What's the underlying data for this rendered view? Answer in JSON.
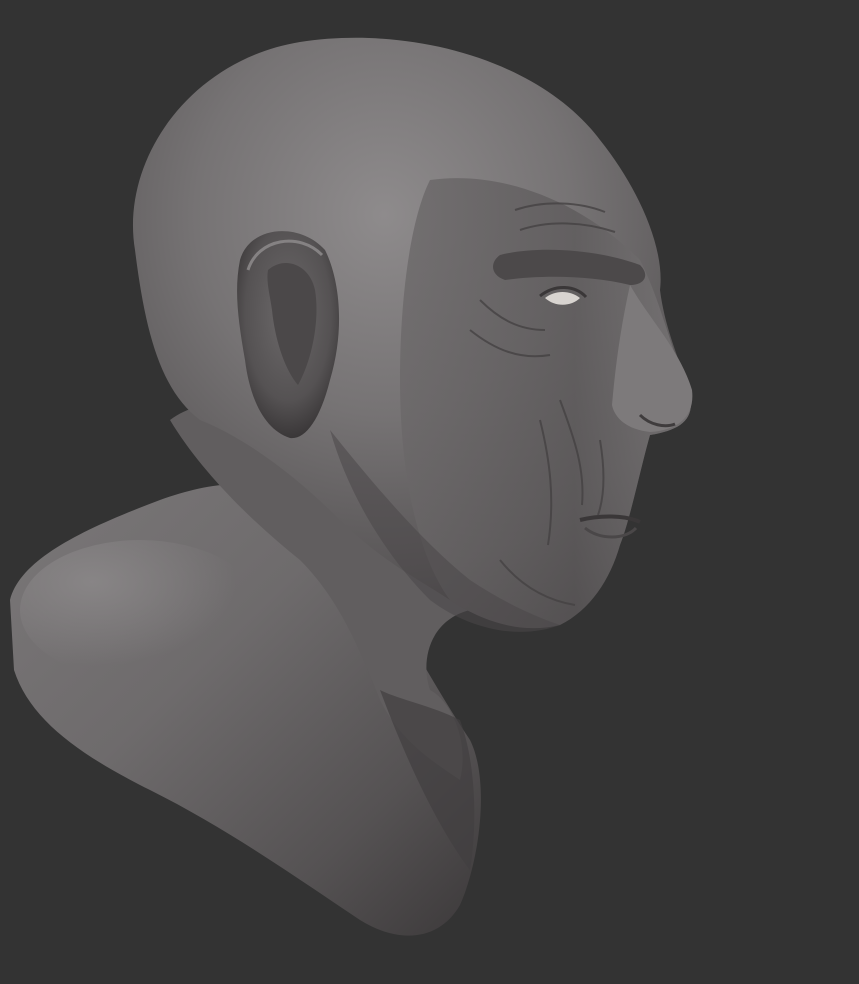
{
  "scene": {
    "subject": "sculpted-head-bust",
    "material": "clay",
    "colors": {
      "background": "#333333",
      "clay_light": "#8a8788",
      "clay_mid": "#6b6869",
      "clay_dark": "#3f3c3d",
      "eye": "#d8d4d0"
    }
  }
}
